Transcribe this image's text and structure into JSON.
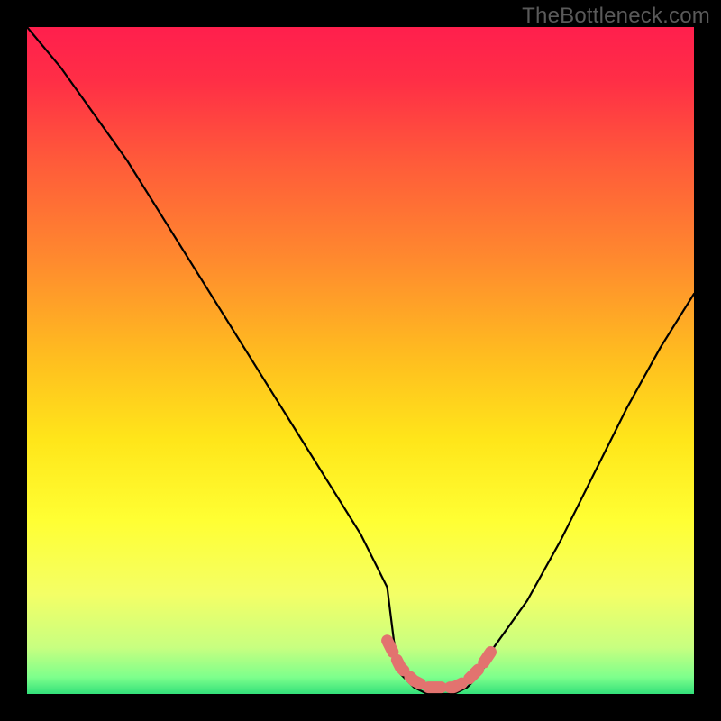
{
  "watermark": "TheBottleneck.com",
  "chart_data": {
    "type": "line",
    "title": "",
    "xlabel": "",
    "ylabel": "",
    "xlim": [
      0,
      100
    ],
    "ylim": [
      0,
      100
    ],
    "x": [
      0,
      5,
      10,
      15,
      20,
      25,
      30,
      35,
      40,
      45,
      50,
      54,
      55,
      56,
      58,
      60,
      62,
      64,
      66,
      68,
      70,
      75,
      80,
      85,
      90,
      95,
      100
    ],
    "curve": [
      100,
      94,
      87,
      80,
      72,
      64,
      56,
      48,
      40,
      32,
      24,
      16,
      8,
      3,
      1,
      0,
      0,
      0,
      1,
      3,
      7,
      14,
      23,
      33,
      43,
      52,
      60
    ],
    "marker_band": {
      "x": [
        54,
        55,
        56,
        58,
        60,
        62,
        64,
        66,
        68,
        70
      ],
      "y": [
        8,
        6,
        4,
        2,
        1,
        1,
        1,
        2,
        4,
        7
      ]
    },
    "background_gradient_stops": [
      {
        "offset": 0.0,
        "color": "#ff1f4d"
      },
      {
        "offset": 0.08,
        "color": "#ff2e46"
      },
      {
        "offset": 0.2,
        "color": "#ff5a3a"
      },
      {
        "offset": 0.35,
        "color": "#ff8a2e"
      },
      {
        "offset": 0.5,
        "color": "#ffbf1f"
      },
      {
        "offset": 0.62,
        "color": "#ffe61a"
      },
      {
        "offset": 0.74,
        "color": "#ffff33"
      },
      {
        "offset": 0.85,
        "color": "#f4ff66"
      },
      {
        "offset": 0.93,
        "color": "#c8ff80"
      },
      {
        "offset": 0.975,
        "color": "#7dff8c"
      },
      {
        "offset": 1.0,
        "color": "#33e07a"
      }
    ],
    "colors": {
      "curve": "#000000",
      "marker": "#e2736f"
    }
  }
}
